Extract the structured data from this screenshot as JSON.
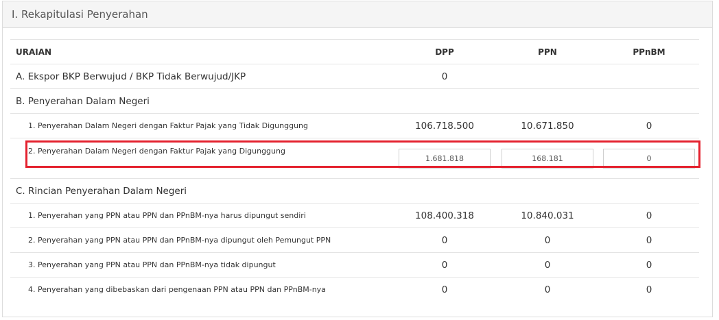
{
  "panel": {
    "title": "I. Rekapitulasi Penyerahan"
  },
  "table": {
    "headers": {
      "uraian": "URAIAN",
      "dpp": "DPP",
      "ppn": "PPN",
      "ppnbm": "PPnBM"
    },
    "row_a": {
      "label": "A. Ekspor BKP Berwujud / BKP Tidak Berwujud/JKP",
      "dpp": "0",
      "ppn": "",
      "ppnbm": ""
    },
    "row_b": {
      "label": "B. Penyerahan Dalam Negeri"
    },
    "row_b1": {
      "label": "1. Penyerahan Dalam Negeri dengan Faktur Pajak yang Tidak Digunggung",
      "dpp": "106.718.500",
      "ppn": "10.671.850",
      "ppnbm": "0"
    },
    "row_b2": {
      "label": "2. Penyerahan Dalam Negeri dengan Faktur Pajak yang Digunggung",
      "dpp": "1.681.818",
      "ppn": "168.181",
      "ppnbm": "0"
    },
    "row_c": {
      "label": "C. Rincian Penyerahan Dalam Negeri"
    },
    "row_c1": {
      "label": "1. Penyerahan yang PPN atau PPN dan PPnBM-nya harus dipungut sendiri",
      "dpp": "108.400.318",
      "ppn": "10.840.031",
      "ppnbm": "0"
    },
    "row_c2": {
      "label": "2. Penyerahan yang PPN atau PPN dan PPnBM-nya dipungut oleh Pemungut PPN",
      "dpp": "0",
      "ppn": "0",
      "ppnbm": "0"
    },
    "row_c3": {
      "label": "3. Penyerahan yang PPN atau PPN dan PPnBM-nya tidak dipungut",
      "dpp": "0",
      "ppn": "0",
      "ppnbm": "0"
    },
    "row_c4": {
      "label": "4. Penyerahan yang dibebaskan dari pengenaan PPN atau PPN dan PPnBM-nya",
      "dpp": "0",
      "ppn": "0",
      "ppnbm": "0"
    }
  },
  "highlight_color": "#e4212e"
}
